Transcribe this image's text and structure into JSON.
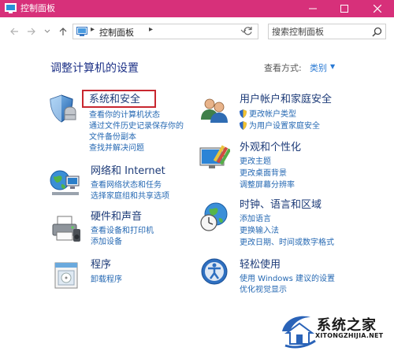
{
  "window": {
    "title": "控制面板",
    "accent_color": "#d7307a",
    "minimize_icon": "minimize-icon",
    "maximize_icon": "maximize-icon",
    "close_icon": "close-icon"
  },
  "navigation": {
    "address_path": "控制面板",
    "search_placeholder": "搜索控制面板"
  },
  "content": {
    "heading": "调整计算机的设置",
    "view_by_label": "查看方式:",
    "view_by_value": "类别"
  },
  "categories": [
    {
      "id": "system-security",
      "title": "系统和安全",
      "icon": "shield-icon",
      "links": [
        "查看你的计算机状态",
        "通过文件历史记录保存你的",
        "文件备份副本",
        "查找并解决问题"
      ]
    },
    {
      "id": "network-internet",
      "title": "网络和 Internet",
      "icon": "network-globe-icon",
      "links": [
        "查看网络状态和任务",
        "选择家庭组和共享选项"
      ]
    },
    {
      "id": "hardware-sound",
      "title": "硬件和声音",
      "icon": "printer-icon",
      "links": [
        "查看设备和打印机",
        "添加设备"
      ]
    },
    {
      "id": "programs",
      "title": "程序",
      "icon": "programs-icon",
      "links": [
        "卸载程序"
      ]
    },
    {
      "id": "user-accounts",
      "title": "用户帐户和家庭安全",
      "icon": "users-icon",
      "links": [
        "更改帐户类型",
        "为用户设置家庭安全"
      ]
    },
    {
      "id": "appearance",
      "title": "外观和个性化",
      "icon": "appearance-icon",
      "links": [
        "更改主题",
        "更改桌面背景",
        "调整屏幕分辨率"
      ]
    },
    {
      "id": "clock-language",
      "title": "时钟、语言和区域",
      "icon": "clock-globe-icon",
      "links": [
        "添加语言",
        "更换输入法",
        "更改日期、时间或数字格式"
      ]
    },
    {
      "id": "ease-of-access",
      "title": "轻松使用",
      "icon": "ease-of-access-icon",
      "links": [
        "使用 Windows 建议的设置",
        "优化视觉显示"
      ]
    }
  ],
  "watermark": {
    "name": "系统之家",
    "url": "XITONGZHIJIA.NET"
  }
}
